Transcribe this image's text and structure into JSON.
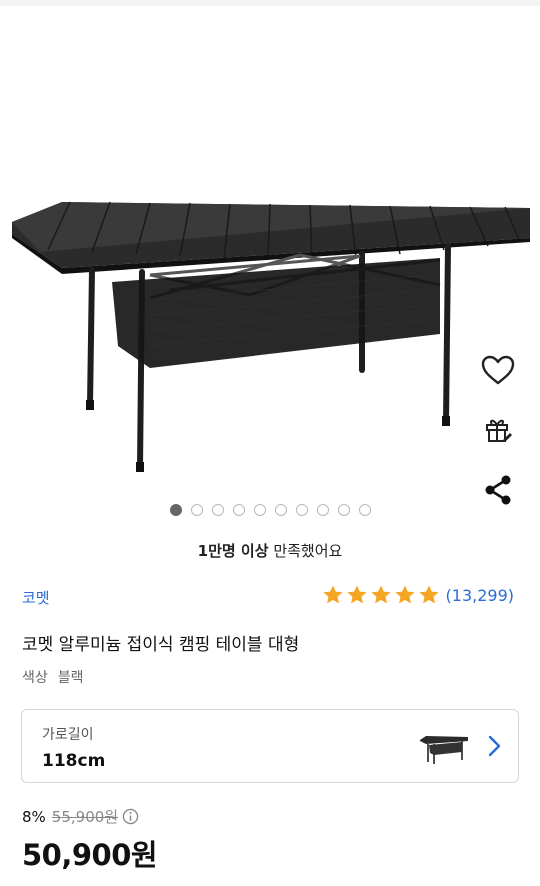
{
  "gallery": {
    "image_alt": "코멧 알루미늄 접이식 캠핑 테이블 대형",
    "dot_count": 10,
    "active_index": 0
  },
  "actions": {
    "wishlist_icon": "heart-icon",
    "gift_icon": "gift-icon",
    "share_icon": "share-icon"
  },
  "satisfaction": {
    "bold": "1만명 이상",
    "rest": " 만족했어요"
  },
  "product": {
    "brand": "코멧",
    "rating": 5,
    "review_count": "(13,299)",
    "title": "코멧 알루미늄 접이식 캠핑 테이블 대형",
    "option_name": "색상",
    "option_value": "블랙"
  },
  "option_selector": {
    "label": "가로길이",
    "value": "118cm"
  },
  "price": {
    "discount_rate": "8%",
    "original": "55,900원",
    "sale": "50,900원"
  },
  "colors": {
    "brand_blue": "#2a6bd8",
    "star": "#f5a623"
  }
}
